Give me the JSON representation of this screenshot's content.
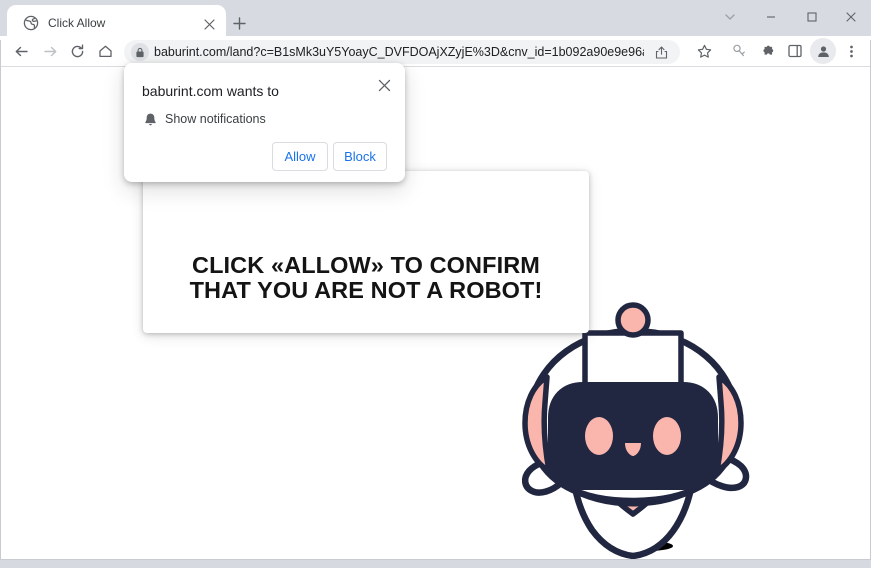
{
  "window": {
    "controls": {
      "tab_search": "tab-search-chevron",
      "minimize": "minimize",
      "maximize": "maximize",
      "close": "close"
    }
  },
  "tabstrip": {
    "tab": {
      "title": "Click Allow",
      "favicon": "globe-icon",
      "close_label": "×"
    },
    "new_tab_label": "+"
  },
  "toolbar": {
    "back": "back-arrow",
    "forward": "forward-arrow",
    "reload": "reload",
    "home": "home",
    "omnibox": {
      "url": "baburint.com/land?c=B1sMk3uY5YoayC_DVFDOAjXZyjE%3D&cnv_id=1b092a90e9e96a338f...",
      "domain": "baburint.com",
      "lock_icon": "lock-icon",
      "share_icon": "share-icon"
    },
    "bookmark": "star-icon",
    "tracking": "tracking-protection-icon",
    "extensions": "puzzle-icon",
    "side_panel": "side-panel-icon",
    "profile": "avatar-icon",
    "menu": "three-dot-menu-icon"
  },
  "permission_dialog": {
    "title": "baburint.com wants to",
    "option_icon": "bell-icon",
    "option_label": "Show notifications",
    "allow_label": "Allow",
    "block_label": "Block",
    "close_label": "×"
  },
  "page": {
    "bubble_text": "CLICK «ALLOW» TO CONFIRM THAT YOU ARE NOT A ROBOT!",
    "mascot": "robot-mascot"
  },
  "colors": {
    "robot_outline": "#222741",
    "robot_pink": "#fab5ac",
    "robot_white": "#ffffff",
    "link_blue": "#1a73e8",
    "chrome_bg": "#d7dbe1",
    "page_bg": "#ffffff"
  }
}
